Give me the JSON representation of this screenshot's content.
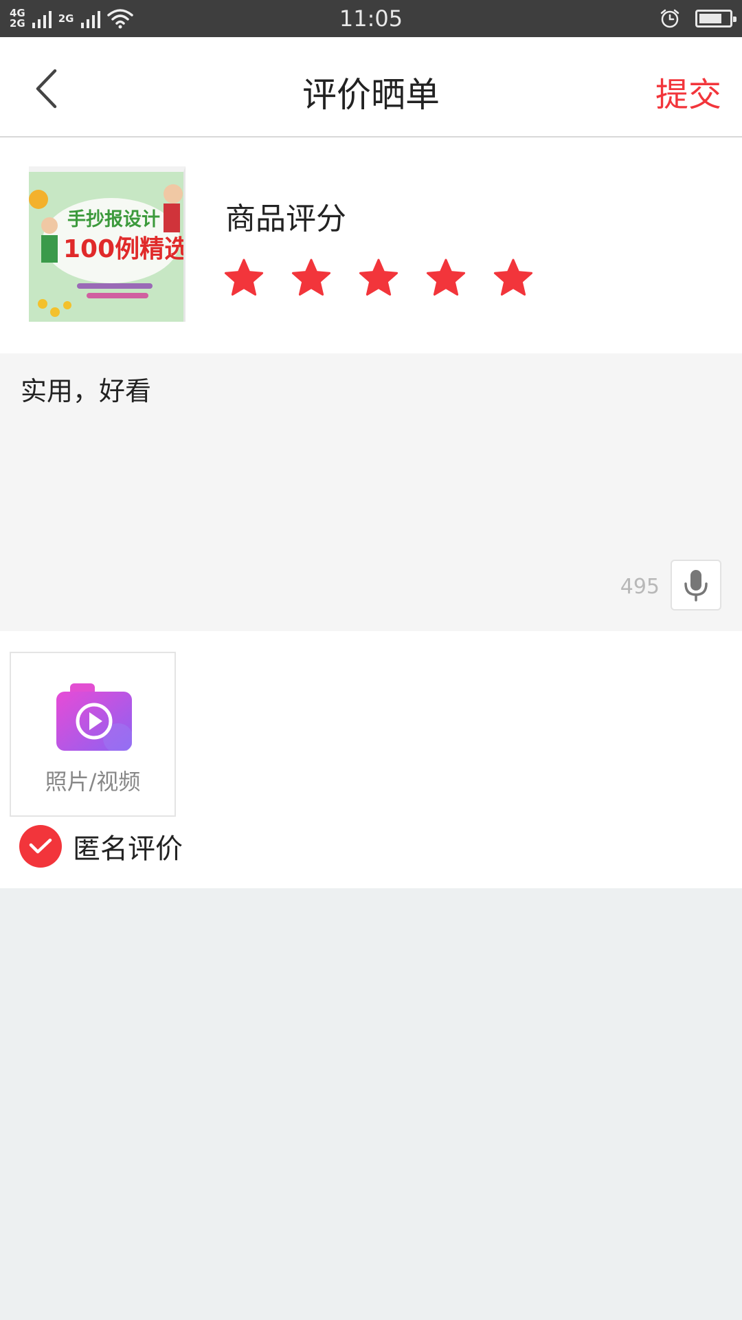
{
  "status_bar": {
    "net1": "4G",
    "net1b": "2G",
    "net2": "2G",
    "time": "11:05"
  },
  "nav": {
    "title": "评价晒单",
    "submit_label": "提交"
  },
  "product": {
    "rating_label": "商品评分",
    "rating": 5,
    "rating_max": 5,
    "cover_title_line1": "手抄报设计",
    "cover_title_line2": "100例精选"
  },
  "review": {
    "text": "实用，好看",
    "remaining_chars": "495"
  },
  "media": {
    "upload_label": "照片/视频"
  },
  "anonymous": {
    "label": "匿名评价",
    "checked": true
  },
  "colors": {
    "accent": "#f2353b",
    "status_bar": "#3e3e3e",
    "page_bg": "#edf0f1"
  }
}
